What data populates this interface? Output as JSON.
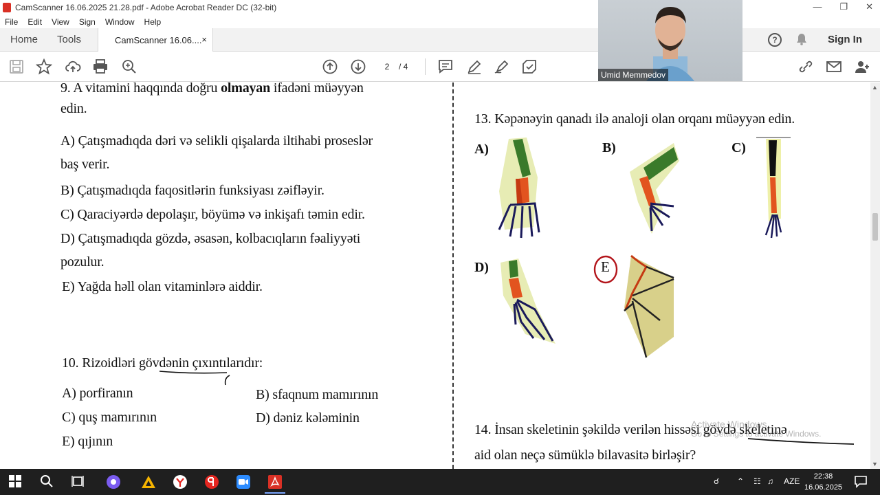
{
  "window": {
    "title": "CamScanner 16.06.2025 21.28.pdf - Adobe Acrobat Reader DC (32-bit)"
  },
  "menu": [
    "File",
    "Edit",
    "View",
    "Sign",
    "Window",
    "Help"
  ],
  "tabs": {
    "home": "Home",
    "tools": "Tools",
    "document": "CamScanner 16.06....",
    "close": "×",
    "sign_in": "Sign In",
    "help": "?"
  },
  "toolbar": {
    "current_page": "2",
    "total_pages": "/  4"
  },
  "webcam": {
    "name": "Umid Memmedov"
  },
  "document": {
    "q9": {
      "stem_line1": "9. A vitamini haqqında doğru",
      "stem_bold": "olmayan",
      "stem_line1_end": "ifadəni müəyyən",
      "stem_line2": "edin.",
      "a1": "A) Çatışmadıqda dəri və selikli qişalarda iltihabi proseslər",
      "a2": "baş verir.",
      "b": "B) Çatışmadıqda faqositlərin funksiyası zəifləyir.",
      "c": "C) Qaraciyərdə depolaşır, böyümə və inkişafı təmin edir.",
      "d1": "D) Çatışmadıqda gözdə, əsasən, kolbacıqların fəaliyyəti",
      "d2": "pozulur.",
      "e": "E) Yağda həll olan vitaminlərə aiddir."
    },
    "q10": {
      "stem": "10. Rizoidləri gövdənin çıxıntılarıdır:",
      "a": "A) porfiranın",
      "b": "B) sfaqnum mamırının",
      "c": "C) quş mamırının",
      "d": "D) dəniz kələminin",
      "e": "E) qıjının"
    },
    "q13": {
      "stem": "13. Kəpənəyin qanadı ilə analoji olan orqanı müəyyən edin.",
      "a": "A)",
      "b": "B)",
      "c": "C)",
      "d": "D)",
      "e": "E"
    },
    "q14": {
      "line1": "14. İnsan skeletinin şəkildə verilən hissəsi gövdə skeletinə",
      "line2": "aid olan neçə sümüklə bilavasitə birləşir?"
    }
  },
  "watermark": {
    "line1": "Activate Windows",
    "line2": "Go to Settings to activate Windows."
  },
  "taskbar": {
    "lang": "AZE",
    "time": "22:38",
    "date": "16.06.2025"
  }
}
